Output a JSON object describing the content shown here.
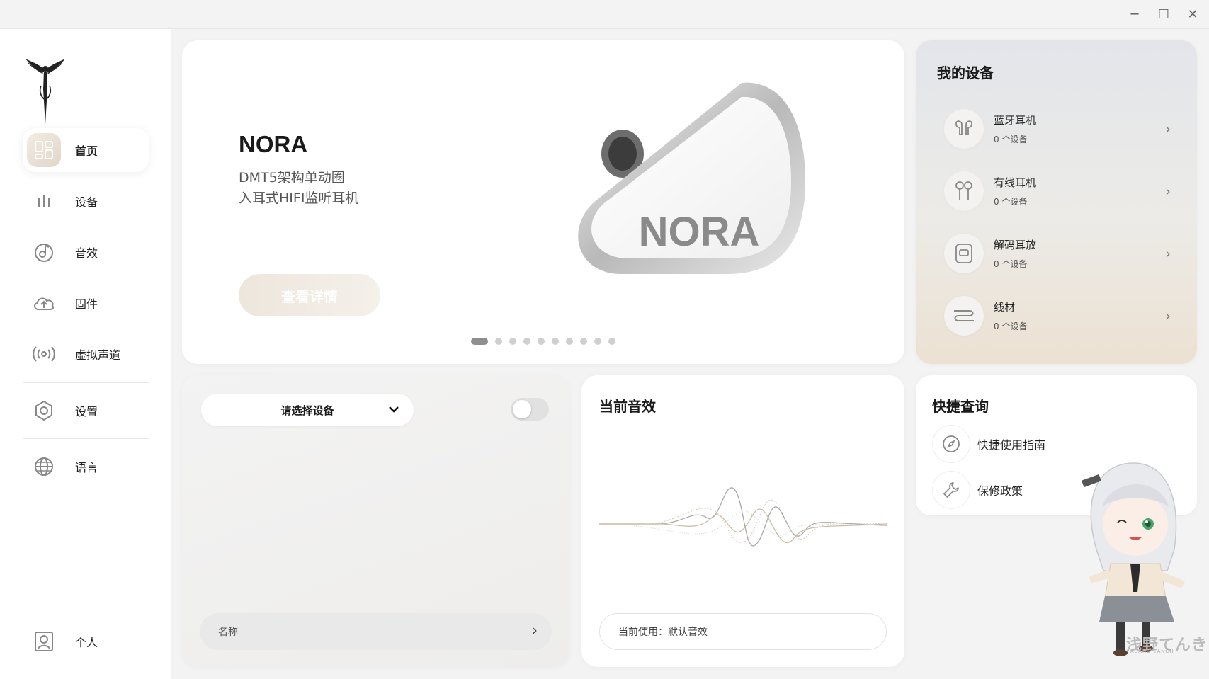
{
  "window": {
    "minimize_glyph": "─",
    "maximize_glyph": "☐",
    "close_glyph": "✕"
  },
  "sidebar": {
    "logo_icon": "angel-logo-icon",
    "items": [
      {
        "label": "首页",
        "icon": "home-dashboard-icon",
        "active": true
      },
      {
        "label": "设备",
        "icon": "equalizer-bars-icon"
      },
      {
        "label": "音效",
        "icon": "music-disc-icon"
      },
      {
        "label": "固件",
        "icon": "cloud-upload-icon"
      },
      {
        "label": "虚拟声道",
        "icon": "broadcast-icon"
      },
      {
        "label": "设置",
        "icon": "hexagon-gear-icon"
      },
      {
        "label": "语言",
        "icon": "globe-icon"
      }
    ],
    "profile": {
      "label": "个人",
      "icon": "user-profile-icon"
    }
  },
  "hero": {
    "title": "NORA",
    "subtitle_line1": "DMT5架构单动圈",
    "subtitle_line2": "入耳式HIFI监听耳机",
    "button_label": "查看详情",
    "product_logo_text": "NORA",
    "carousel_total": 10,
    "carousel_active": 1
  },
  "my_devices": {
    "title": "我的设备",
    "items": [
      {
        "name": "蓝牙耳机",
        "count": "0 个设备",
        "icon": "earbuds-icon"
      },
      {
        "name": "有线耳机",
        "count": "0 个设备",
        "icon": "wired-earbuds-icon"
      },
      {
        "name": "解码耳放",
        "count": "0 个设备",
        "icon": "dac-amp-icon"
      },
      {
        "name": "线材",
        "count": "0 个设备",
        "icon": "cable-icon"
      }
    ]
  },
  "device_selector": {
    "select_label": "请选择设备",
    "toggle_on": false,
    "name_label": "名称"
  },
  "current_effect": {
    "title": "当前音效",
    "current_label": "当前使用：",
    "current_value": "默认音效"
  },
  "quick_query": {
    "title": "快捷查询",
    "items": [
      {
        "label": "快捷使用指南",
        "icon": "compass-icon"
      },
      {
        "label": "保修政策",
        "icon": "wrench-icon"
      }
    ]
  },
  "watermark": {
    "text": "浅野てんき",
    "sub": "ASANO·TANCH"
  },
  "colors": {
    "accent_beige": "#e8ded0",
    "background": "#f3f3f3",
    "card": "#ffffff"
  }
}
